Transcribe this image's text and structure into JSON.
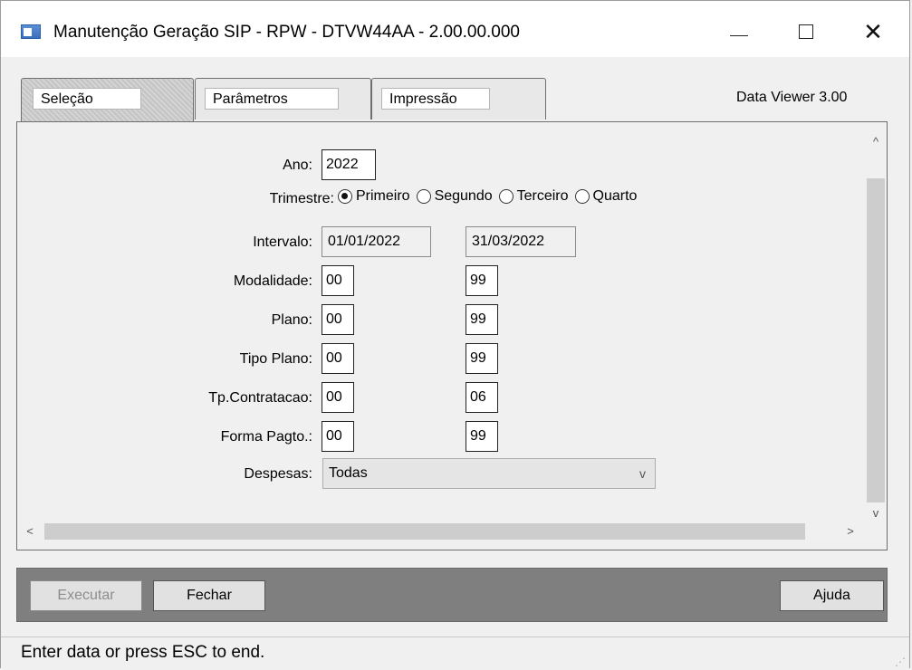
{
  "window": {
    "title": "Manutenção Geração SIP - RPW - DTVW44AA - 2.00.00.000",
    "minimize_glyph": "—",
    "close_glyph": "✕"
  },
  "tabs": [
    {
      "label": "Seleção",
      "active": true
    },
    {
      "label": "Parâmetros",
      "active": false
    },
    {
      "label": "Impressão",
      "active": false
    }
  ],
  "data_viewer_label": "Data Viewer 3.00",
  "form": {
    "ano_label": "Ano:",
    "ano_value": "2022",
    "trimestre_label": "Trimestre:",
    "trimestre_options": [
      "Primeiro",
      "Segundo",
      "Terceiro",
      "Quarto"
    ],
    "trimestre_selected": "Primeiro",
    "intervalo_label": "Intervalo:",
    "intervalo_from": "01/01/2022",
    "intervalo_to": "31/03/2022",
    "modalidade_label": "Modalidade:",
    "modalidade_from": "00",
    "modalidade_to": "99",
    "plano_label": "Plano:",
    "plano_from": "00",
    "plano_to": "99",
    "tipo_plano_label": "Tipo Plano:",
    "tipo_plano_from": "00",
    "tipo_plano_to": "99",
    "tp_contratacao_label": "Tp.Contratacao:",
    "tp_contratacao_from": "00",
    "tp_contratacao_to": "06",
    "forma_pagto_label": "Forma Pagto.:",
    "forma_pagto_from": "00",
    "forma_pagto_to": "99",
    "despesas_label": "Despesas:",
    "despesas_value": "Todas"
  },
  "buttons": {
    "executar": "Executar",
    "fechar": "Fechar",
    "ajuda": "Ajuda"
  },
  "status": "Enter data or press ESC to end.",
  "icons": {
    "scroll_up": "^",
    "scroll_down": "v",
    "scroll_left": "<",
    "scroll_right": ">",
    "dropdown": "v"
  }
}
